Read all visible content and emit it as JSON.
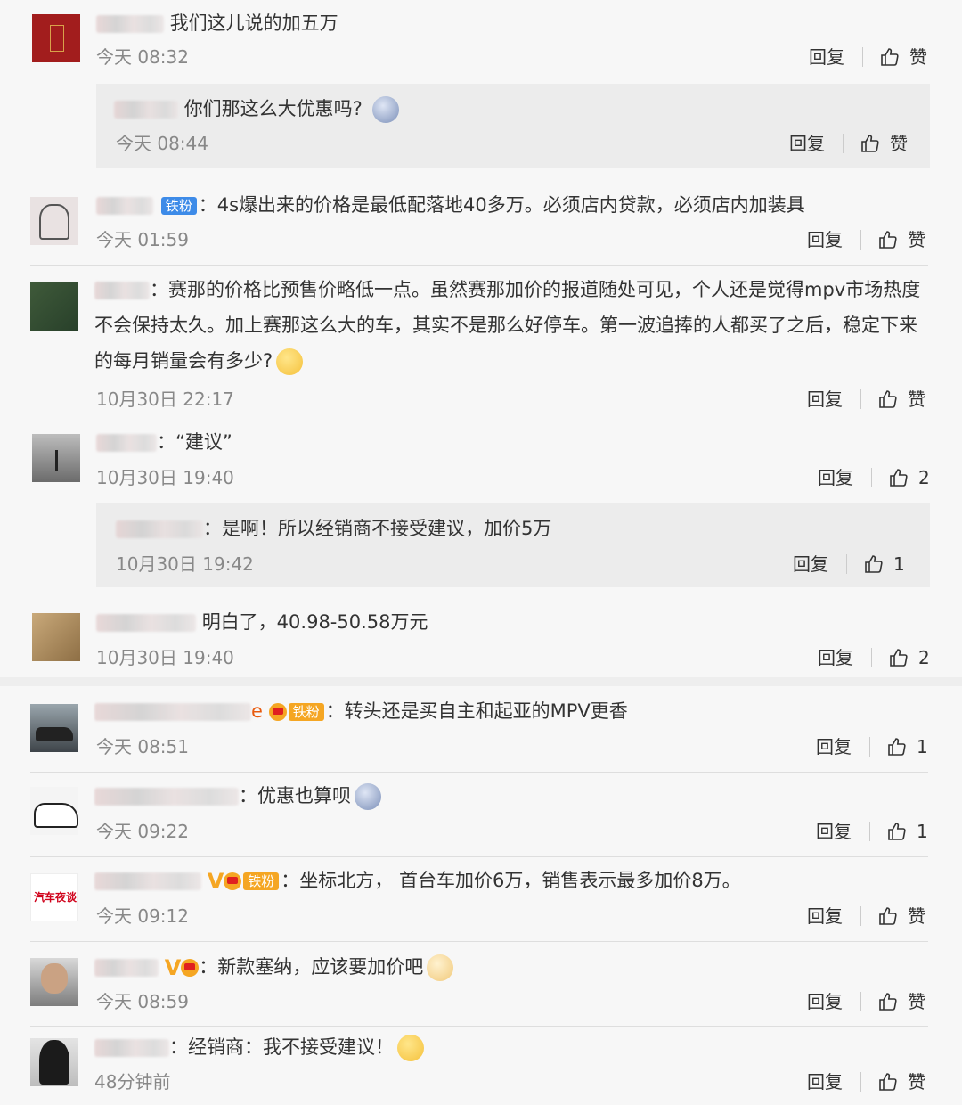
{
  "comments": [
    {
      "text": "我们这儿说的加五万",
      "time": "今天 08:32",
      "reply_label": "回复",
      "like_label": "赞",
      "reply": {
        "text": "你们那这么大优惠吗?",
        "time": "今天 08:44",
        "reply_label": "回复",
        "like_label": "赞"
      }
    },
    {
      "badge": "铁粉",
      "text": "4s爆出来的价格是最低配落地40多万。必须店内贷款，必须店内加装具",
      "time": "今天 01:59",
      "reply_label": "回复",
      "like_label": "赞"
    },
    {
      "text": "赛那的价格比预售价略低一点。虽然赛那加价的报道随处可见，个人还是觉得mpv市场热度不会保持太久。加上赛那这么大的车，其实不是那么好停车。第一波追捧的人都买了之后，稳定下来的每月销量会有多少?",
      "time": "10月30日 22:17",
      "reply_label": "回复",
      "like_label": "赞"
    },
    {
      "text": "“建议”",
      "time": "10月30日 19:40",
      "reply_label": "回复",
      "like_label": "2",
      "reply": {
        "text": "是啊！所以经销商不接受建议，加价5万",
        "time": "10月30日 19:42",
        "reply_label": "回复",
        "like_label": "1"
      }
    },
    {
      "text": "明白了，40.98-50.58万元",
      "time": "10月30日 19:40",
      "reply_label": "回复",
      "like_label": "2"
    },
    {
      "name_tail": "e",
      "badge": "铁粉",
      "text": "转头还是买自主和起亚的MPV更香",
      "time": "今天 08:51",
      "reply_label": "回复",
      "like_label": "1"
    },
    {
      "text": "优惠也算呗",
      "time": "今天 09:22",
      "reply_label": "回复",
      "like_label": "1"
    },
    {
      "badge": "铁粉",
      "avatar_text": "汽车夜谈",
      "text": "坐标北方， 首台车加价6万，销售表示最多加价8万。",
      "time": "今天 09:12",
      "reply_label": "回复",
      "like_label": "赞"
    },
    {
      "text": "新款塞纳，应该要加价吧",
      "time": "今天 08:59",
      "reply_label": "回复",
      "like_label": "赞"
    },
    {
      "text": "经销商：我不接受建议！",
      "time": "48分钟前",
      "reply_label": "回复",
      "like_label": "赞"
    }
  ],
  "colors": {
    "badge_blue": "#3d8be8",
    "badge_orange": "#f5a623",
    "vip": "#f5a623"
  },
  "icons": {
    "like": "thumbs-up-icon"
  }
}
